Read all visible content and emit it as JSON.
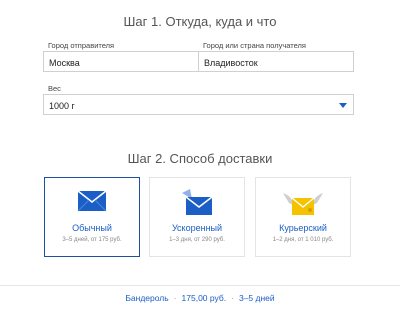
{
  "step1": {
    "title": "Шаг 1. Откуда, куда и что",
    "from_label": "Город отправителя",
    "from_value": "Москва",
    "to_label": "Город или страна получателя",
    "to_value": "Владивосток",
    "weight_label": "Вес",
    "weight_value": "1000 г"
  },
  "step2": {
    "title": "Шаг 2. Способ доставки",
    "options": [
      {
        "name": "Обычный",
        "details": "3–5 дней, от 175 руб.",
        "selected": true
      },
      {
        "name": "Ускоренный",
        "details": "1–3 дня, от 290 руб.",
        "selected": false
      },
      {
        "name": "Курьерский",
        "details": "1–2 дня, от 1 010 руб.",
        "selected": false
      }
    ]
  },
  "summary": {
    "type": "Бандероль",
    "price": "175,00 руб.",
    "duration": "3–5 дней",
    "separator": "·"
  },
  "colors": {
    "accent": "#1a5ec6",
    "selected_border": "#1f4fa0",
    "courier_envelope": "#f5c200"
  }
}
